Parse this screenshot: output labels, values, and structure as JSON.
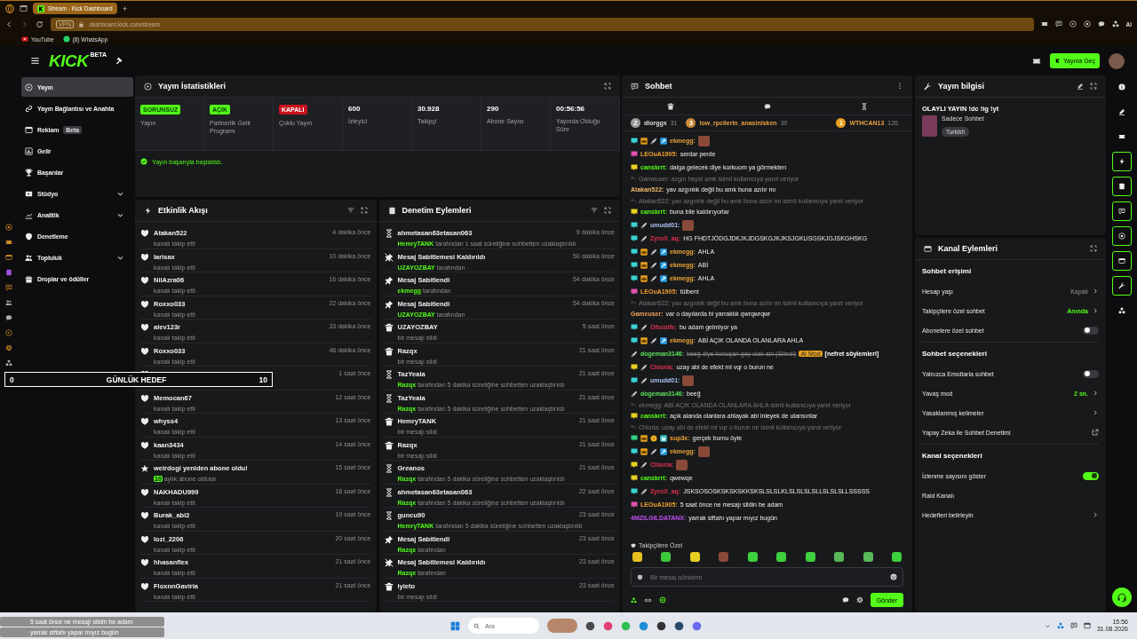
{
  "browser": {
    "tab_title": "Stream - Kick Dashboard",
    "new_tab": "+",
    "vpn": "VPN",
    "address": "dashboard.kick.com/stream",
    "bookmarks": [
      "YouTube",
      "(8) WhatsApp"
    ],
    "ai_label": "AI"
  },
  "header": {
    "logo": "KICK",
    "logo_tag": "BETA",
    "go_live": "Yayına Geç"
  },
  "nav": [
    {
      "label": "Yayın",
      "selected": true
    },
    {
      "label": "Yayın Bağlantısı ve Anahta",
      "selected": false
    },
    {
      "label": "Reklam",
      "selected": false,
      "tag": "Beta"
    },
    {
      "label": "Gelir",
      "selected": false
    },
    {
      "label": "Başarılar",
      "selected": false
    },
    {
      "label": "Stüdyo",
      "selected": false,
      "expanded": false
    },
    {
      "label": "Analitik",
      "selected": false,
      "expanded": false
    },
    {
      "label": "Denetleme",
      "selected": false
    },
    {
      "label": "Topluluk",
      "selected": false,
      "expanded": false
    },
    {
      "label": "Droplar ve ödüller",
      "selected": false
    }
  ],
  "stats": {
    "title": "Yayın İstatistikleri",
    "cells": [
      {
        "kind": "status",
        "badge": "SORUNSUZ",
        "on": true,
        "label": "Yayın"
      },
      {
        "kind": "status",
        "badge": "AÇIK",
        "on": true,
        "label": "Partnerlik Gelir Programı"
      },
      {
        "kind": "status",
        "badge": "KAPALI",
        "on": false,
        "label": "Çoklu Yayın"
      },
      {
        "kind": "number",
        "value": "600",
        "label": "İzleyici"
      },
      {
        "kind": "number",
        "value": "30.928",
        "label": "Takipçi"
      },
      {
        "kind": "number",
        "value": "290",
        "label": "Abone Sayısı"
      },
      {
        "kind": "number",
        "value": "00:56:56",
        "label": "Yayında Olduğu Süre"
      }
    ],
    "notice": "Yayın başarıyla başlatıldı."
  },
  "activity": {
    "title": "Etkinlik Akışı",
    "items": [
      {
        "kind": "follow",
        "user": "Atakan522",
        "detail": "kanalı takip etti",
        "time": "4 dakika önce"
      },
      {
        "kind": "follow",
        "user": "larisax",
        "detail": "kanalı takip etti",
        "time": "10 dakika önce"
      },
      {
        "kind": "follow",
        "user": "NilAzra06",
        "detail": "kanalı takip etti",
        "time": "16 dakika önce"
      },
      {
        "kind": "follow",
        "user": "Roxxo033",
        "detail": "kanalı takip etti",
        "time": "22 dakika önce"
      },
      {
        "kind": "follow",
        "user": "alev123r",
        "detail": "kanalı takip etti",
        "time": "33 dakika önce"
      },
      {
        "kind": "follow",
        "user": "Roxxo033",
        "detail": "kanalı takip etti",
        "time": "46 dakika önce"
      },
      {
        "kind": "follow",
        "time": "1 saat önce"
      },
      {
        "kind": "follow",
        "user": "Memocan67",
        "detail": "kanalı takip etti",
        "time": "12 saat önce"
      },
      {
        "kind": "follow",
        "user": "whyss4",
        "detail": "kanalı takip etti",
        "time": "13 saat önce"
      },
      {
        "kind": "follow",
        "user": "kaan3434",
        "detail": "kanalı takip etti",
        "time": "14 saat önce"
      },
      {
        "kind": "resub",
        "user": "weirdogi yeniden abone oldu!",
        "months": "10",
        "detail": "aylık abone oldular",
        "time": "15 saat önce"
      },
      {
        "kind": "follow",
        "user": "NAKHADU999",
        "detail": "kanalı takip etti",
        "time": "18 saat önce"
      },
      {
        "kind": "follow",
        "user": "Burak_abi2",
        "detail": "kanalı takip etti",
        "time": "19 saat önce"
      },
      {
        "kind": "follow",
        "user": "lozi_2206",
        "detail": "kanalı takip etti",
        "time": "20 saat önce"
      },
      {
        "kind": "follow",
        "user": "hhasanflex",
        "detail": "kanalı takip etti",
        "time": "21 saat önce"
      },
      {
        "kind": "follow",
        "user": "FloxnnGaviria",
        "detail": "kanalı takip etti",
        "time": "21 saat önce"
      }
    ]
  },
  "moderation": {
    "title": "Denetim Eylemleri",
    "items": [
      {
        "kind": "timeout",
        "user": "ahmetasan63etasan063",
        "actor": "HemryTANK",
        "detail": "tarafından 1 saat süreliğine sohbetten uzaklaştırıldı",
        "time": "9 dakika önce"
      },
      {
        "kind": "unpin",
        "user": "Mesaj Sabitlemesi Kaldırıldı",
        "actor": "UZAYOZBAY",
        "detail": "tarafından",
        "time": "50 dakika önce"
      },
      {
        "kind": "pin",
        "user": "Mesaj Sabitlendi",
        "actor": "ekmegg",
        "detail": "tarafından",
        "time": "54 dakika önce"
      },
      {
        "kind": "pin",
        "user": "Mesaj Sabitlendi",
        "actor": "UZAYOZBAY",
        "detail": "tarafından",
        "time": "54 dakika önce"
      },
      {
        "kind": "delete",
        "user": "UZAYOZBAY",
        "detail": "bir mesajı sildi",
        "time": "5 saat önce"
      },
      {
        "kind": "delete",
        "user": "Razqx",
        "detail": "bir mesajı sildi",
        "time": "21 saat önce"
      },
      {
        "kind": "timeout",
        "user": "TazYeala",
        "actor": "Razqx",
        "detail": "tarafından 5 dakika süreliğine sohbetten uzaklaştırıldı",
        "time": "21 saat önce"
      },
      {
        "kind": "timeout",
        "user": "TazYeala",
        "actor": "Razqx",
        "detail": "tarafından 5 dakika süreliğine sohbetten uzaklaştırıldı",
        "time": "21 saat önce"
      },
      {
        "kind": "delete",
        "user": "HemryTANK",
        "detail": "bir mesajı sildi",
        "time": "21 saat önce"
      },
      {
        "kind": "delete",
        "user": "Razqx",
        "detail": "bir mesajı sildi",
        "time": "21 saat önce"
      },
      {
        "kind": "timeout",
        "user": "Greanos",
        "actor": "Razqx",
        "detail": "tarafından 5 dakika süreliğine sohbetten uzaklaştırıldı",
        "time": "21 saat önce"
      },
      {
        "kind": "timeout",
        "user": "ahmetasan63etasan063",
        "actor": "Razqx",
        "detail": "tarafından 5 dakika süreliğine sohbetten uzaklaştırıldı",
        "time": "22 saat önce"
      },
      {
        "kind": "timeout",
        "user": "guncu90",
        "actor": "HemryTANK",
        "detail": "tarafından 5 dakika süreliğine sohbetten uzaklaştırıldı",
        "time": "23 saat önce"
      },
      {
        "kind": "pin",
        "user": "Mesaj Sabitlendi",
        "actor": "Razqx",
        "detail": "tarafından",
        "time": "23 saat önce"
      },
      {
        "kind": "unpin",
        "user": "Mesaj Sabitlemesi Kaldırıldı",
        "actor": "Razqx",
        "detail": "tarafından",
        "time": "23 saat önce"
      },
      {
        "kind": "delete",
        "user": "iyieto",
        "detail": "bir mesajı sildi",
        "time": "23 saat önce"
      }
    ]
  },
  "chat": {
    "title": "Sohbet",
    "leaders": [
      {
        "rank": "2",
        "user": "diorggx",
        "count": "31",
        "color": "#9a9a9a"
      },
      {
        "rank": "3",
        "user": "low_rpcilerin_anasinisken",
        "count": "30",
        "color": "#c98a3a"
      },
      {
        "rank": "1",
        "user": "WTHCAN13",
        "count": "126",
        "color": "#e8a020"
      }
    ],
    "messages": [
      {
        "kind": "msg",
        "badges": [
          {
            "kind": "sub"
          },
          {
            "kind": "crown"
          },
          {
            "kind": "sword"
          },
          {
            "kind": "mod"
          }
        ],
        "user": "ekmegg:",
        "color": "#e8a33a",
        "emote": true
      },
      {
        "kind": "msg",
        "badges": [
          {
            "kind": "sub-pink"
          }
        ],
        "user": "LEOuA1905:",
        "color": "#f0a030",
        "text": "serdar perde"
      },
      {
        "kind": "msg",
        "badges": [
          {
            "kind": "sub-gold"
          }
        ],
        "user": "canskrrt:",
        "color": "#53fc18",
        "text": "dalga gelecek diye korkuom ya görmekten"
      },
      {
        "kind": "reply",
        "text": "Gameuser: azgın hepsi amk isimli kullanıcıya yanıt veriyor"
      },
      {
        "kind": "msg",
        "user": "Atakan522:",
        "color": "#f0b870",
        "text": "yav azgınlık değil bu amk buna azılır mı"
      },
      {
        "kind": "reply",
        "text": "Atakan522: yav azgınlık değil bu amk buna azılır mı isimli kullanıcıya yanıt veriyor"
      },
      {
        "kind": "msg",
        "badges": [
          {
            "kind": "sub-gold"
          }
        ],
        "user": "canskrrt:",
        "color": "#53fc18",
        "text": "buna bile kaldırıyorlar"
      },
      {
        "kind": "msg",
        "badges": [
          {
            "kind": "sub"
          },
          {
            "kind": "sword"
          }
        ],
        "user": "umudd01:",
        "color": "#a8c0f0",
        "emote": true
      },
      {
        "kind": "msg",
        "badges": [
          {
            "kind": "sub"
          },
          {
            "kind": "sword"
          }
        ],
        "user": "ZyroX_aq:",
        "color": "#e0304a",
        "text": "HG FHDTJÖDGJDKJKJDGSKGJKJKSJGKUSGSKJGJSKGHSKG"
      },
      {
        "kind": "msg",
        "badges": [
          {
            "kind": "sub"
          },
          {
            "kind": "crown"
          },
          {
            "kind": "sword"
          },
          {
            "kind": "mod"
          }
        ],
        "user": "ekmegg:",
        "color": "#e8a33a",
        "text": "AHLA"
      },
      {
        "kind": "msg",
        "badges": [
          {
            "kind": "sub"
          },
          {
            "kind": "crown"
          },
          {
            "kind": "sword"
          },
          {
            "kind": "mod"
          }
        ],
        "user": "ekmegg:",
        "color": "#e8a33a",
        "text": "ABİ"
      },
      {
        "kind": "msg",
        "badges": [
          {
            "kind": "sub"
          },
          {
            "kind": "crown"
          },
          {
            "kind": "sword"
          },
          {
            "kind": "mod"
          }
        ],
        "user": "ekmegg:",
        "color": "#e8a33a",
        "text": "AHLA"
      },
      {
        "kind": "msg",
        "badges": [
          {
            "kind": "sub-pink"
          }
        ],
        "user": "LEOuA1905:",
        "color": "#f0a030",
        "text": "tülbent"
      },
      {
        "kind": "reply",
        "text": "Atakan522: yav azgınlık değil bu amk buna azılır mı isimli kullanıcıya yanıt veriyor"
      },
      {
        "kind": "msg",
        "user": "Gameuser:",
        "color": "#f0a060",
        "text": "var o dayılarda bi yarraklık qwrqwrqwr"
      },
      {
        "kind": "msg",
        "badges": [
          {
            "kind": "sub"
          },
          {
            "kind": "sword"
          }
        ],
        "user": "Ofsesife:",
        "color": "#e0304a",
        "text": "bu adam gelmiyor ya"
      },
      {
        "kind": "msg",
        "badges": [
          {
            "kind": "sub"
          },
          {
            "kind": "crown"
          },
          {
            "kind": "sword"
          },
          {
            "kind": "mod"
          }
        ],
        "user": "ekmegg:",
        "color": "#e8a33a",
        "text": "ABİ AÇIK OLANDA OLANLARA AHLA"
      },
      {
        "kind": "deleted",
        "badges": [
          {
            "kind": "sword"
          }
        ],
        "user": "dogeman3146:",
        "color": "#5ee05e",
        "text": "beeğ diye konuşan gay olak abi (Silindi)",
        "flag": "AI Mod",
        "reason": "[nefret söylemleri]"
      },
      {
        "kind": "msg",
        "badges": [
          {
            "kind": "sub-gold"
          },
          {
            "kind": "sword"
          }
        ],
        "user": "Chioria:",
        "color": "#e03050",
        "text": "uzay abi de efekt mi vqr o burun ne"
      },
      {
        "kind": "msg",
        "badges": [
          {
            "kind": "sub"
          },
          {
            "kind": "sword"
          }
        ],
        "user": "umudd01:",
        "color": "#a8c0f0",
        "emote": true
      },
      {
        "kind": "msg",
        "badges": [
          {
            "kind": "sword"
          }
        ],
        "user": "dogeman3146:",
        "color": "#5ee05e",
        "text": "beeğ"
      },
      {
        "kind": "reply",
        "text": "ekmegg: ABİ AÇIK OLANDA OLANLARA AHLA isimli kullanıcıya yanıt veriyor"
      },
      {
        "kind": "msg",
        "badges": [
          {
            "kind": "sub-gold"
          }
        ],
        "user": "canskrrt:",
        "color": "#53fc18",
        "text": "açık alanda olanlara ahlayak abi inleyek de utansınlar"
      },
      {
        "kind": "reply",
        "text": "Chioria: uzay abi de efekt mi vqr o burun ne isimli kullanıcıya yanıt veriyor"
      },
      {
        "kind": "msg",
        "badges": [
          {
            "kind": "sub-green"
          },
          {
            "kind": "crown"
          },
          {
            "kind": "coin"
          },
          {
            "kind": "gift"
          }
        ],
        "user": "sup3x:",
        "color": "#f0a030",
        "text": "gerçek burnu öyle"
      },
      {
        "kind": "msg",
        "badges": [
          {
            "kind": "sub"
          },
          {
            "kind": "crown"
          },
          {
            "kind": "sword"
          },
          {
            "kind": "mod"
          }
        ],
        "user": "ekmegg:",
        "color": "#e8a33a",
        "emote": true
      },
      {
        "kind": "msg",
        "badges": [
          {
            "kind": "sub-gold"
          },
          {
            "kind": "sword"
          }
        ],
        "user": "Chioria:",
        "color": "#e03050",
        "emote": true
      },
      {
        "kind": "msg",
        "badges": [
          {
            "kind": "sub-gold"
          }
        ],
        "user": "canskrrt:",
        "color": "#53fc18",
        "text": "qwewqe"
      },
      {
        "kind": "msg",
        "badges": [
          {
            "kind": "sub"
          },
          {
            "kind": "sword"
          }
        ],
        "user": "ZyroX_aq:",
        "color": "#e0304a",
        "text": "JSKSOSOSKSKSKSKKSKSLSLSLKLSLSLSLSLLSLSLSLLSSSSS"
      },
      {
        "kind": "msg",
        "badges": [
          {
            "kind": "sub-pink"
          }
        ],
        "user": "LEOuA1905:",
        "color": "#f0a030",
        "text": "5 saat önce ne mesajı sildin be adam"
      },
      {
        "kind": "msg",
        "user": "4MZILGILDATANX:",
        "color": "#c050f0",
        "text": "yarrak siftahı yapar mıyız bugün"
      }
    ],
    "followers_label": "Takipçilere Özel",
    "input_placeholder": "Bir mesaj gönderin",
    "send": "Gönder"
  },
  "stream_info": {
    "title": "Yayın bilgisi",
    "stream_title": "OLAYLI YAYIN !dc !ig !yt",
    "category": "Sadece Sohbet",
    "tag": "Turkish"
  },
  "channel_actions": {
    "title": "Kanal Eylemleri",
    "sections": [
      {
        "heading": "Sohbet erişimi",
        "rows": [
          {
            "kind": "link",
            "label": "Hesap yaşı",
            "value": "Kapalı",
            "active": false
          },
          {
            "kind": "link",
            "label": "Takipçilere özel sohbet",
            "value": "Anında",
            "active": true
          },
          {
            "kind": "toggle",
            "label": "Abonelere özel sohbet",
            "on": false
          }
        ]
      },
      {
        "heading": "Sohbet seçenekleri",
        "rows": [
          {
            "kind": "toggle",
            "label": "Yalnızca Emotlarla sohbet",
            "on": false
          },
          {
            "kind": "link",
            "label": "Yavaş mod",
            "value": "2 sn.",
            "active": true
          },
          {
            "kind": "link",
            "label": "Yasaklanmış kelimeler"
          },
          {
            "kind": "external",
            "label": "Yapay Zeka ile Sohbet Denetimi"
          }
        ]
      },
      {
        "heading": "Kanal seçenekleri",
        "rows": [
          {
            "kind": "toggle",
            "label": "İzlenme sayısını göster",
            "on": true
          },
          {
            "kind": "plain",
            "label": "Raid Kanalı"
          },
          {
            "kind": "link",
            "label": "Hedefleri belirleyin"
          }
        ]
      }
    ]
  },
  "rail": [
    {
      "active": false
    },
    {
      "active": false
    },
    {
      "active": false
    },
    {
      "active": true
    },
    {
      "active": true
    },
    {
      "active": true
    },
    {
      "active": true
    },
    {
      "active": true
    },
    {
      "active": true
    },
    {
      "active": false
    }
  ],
  "taskbar": {
    "search_placeholder": "Ara",
    "time": "15:56",
    "date": "31.08.2026"
  },
  "overlay": {
    "goal": {
      "current": "0",
      "title": "GÜNLÜK HEDEF",
      "target": "10"
    },
    "chat": [
      "5 saat önce ne mesajı sildin be adam",
      "yarrak siftahı yapar mıyız bugün"
    ]
  }
}
